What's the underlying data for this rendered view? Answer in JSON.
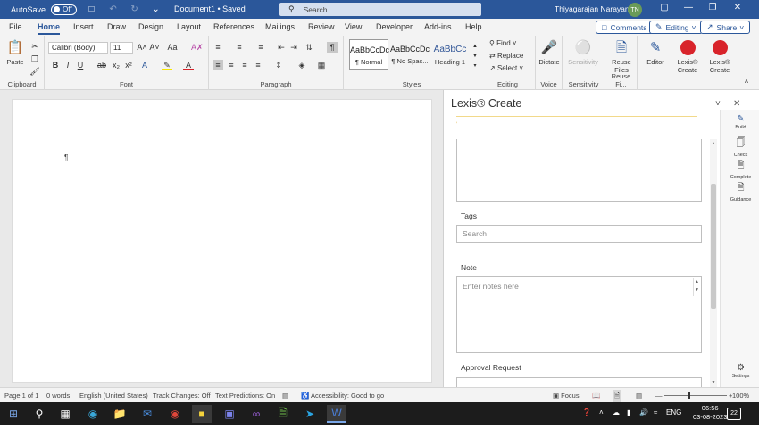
{
  "titlebar": {
    "autosave_label": "AutoSave",
    "autosave_state": "Off",
    "doc_title": "Document1 • Saved",
    "search_placeholder": "Search",
    "user_name": "Thiyagarajan Narayanan",
    "user_initials": "TN"
  },
  "tabs": [
    "File",
    "Home",
    "Insert",
    "Draw",
    "Design",
    "Layout",
    "References",
    "Mailings",
    "Review",
    "View",
    "Developer",
    "Add-ins",
    "Help"
  ],
  "active_tab": "Home",
  "actions": {
    "comments": "Comments",
    "editing": "Editing",
    "share": "Share"
  },
  "ribbon": {
    "clipboard": {
      "label": "Clipboard",
      "paste": "Paste"
    },
    "font": {
      "label": "Font",
      "font_name": "Calibri (Body)",
      "font_size": "11"
    },
    "paragraph": {
      "label": "Paragraph"
    },
    "styles": {
      "label": "Styles",
      "items": [
        {
          "sample": "AaBbCcDc",
          "name": "¶ Normal"
        },
        {
          "sample": "AaBbCcDc",
          "name": "¶ No Spac..."
        },
        {
          "sample": "AaBbCc",
          "name": "Heading 1"
        }
      ]
    },
    "editing": {
      "label": "Editing",
      "find": "Find",
      "replace": "Replace",
      "select": "Select"
    },
    "voice": {
      "label": "Voice",
      "dictate": "Dictate"
    },
    "sensitivity": {
      "label": "Sensitivity",
      "button": "Sensitivity"
    },
    "reuse": {
      "label": "Reuse Fi...",
      "button": "Reuse Files"
    },
    "editor": {
      "button": "Editor"
    },
    "lexis1": {
      "button": "Lexis® Create"
    },
    "lexis2": {
      "button": "Lexis® Create"
    }
  },
  "document": {
    "pilcrow": "¶"
  },
  "pane": {
    "title": "Lexis® Create",
    "tags_label": "Tags",
    "tags_placeholder": "Search",
    "note_label": "Note",
    "note_placeholder": "Enter notes here",
    "approval_label": "Approval Request",
    "tools": [
      {
        "icon": "pencil-icon",
        "label": "Build"
      },
      {
        "icon": "check-icon",
        "label": "Check"
      },
      {
        "icon": "complete-icon",
        "label": "Complete"
      },
      {
        "icon": "guidance-icon",
        "label": "Guidance"
      },
      {
        "icon": "gear-icon",
        "label": "Settings"
      }
    ]
  },
  "status": {
    "page": "Page 1 of 1",
    "words": "0 words",
    "language": "English (United States)",
    "track_changes": "Track Changes: Off",
    "text_predictions": "Text Predictions: On",
    "accessibility": "Accessibility: Good to go",
    "focus": "Focus",
    "zoom": "100%"
  },
  "taskbar": {
    "language": "ENG",
    "time": "06:56",
    "date": "03-08-2023",
    "notifications": "22"
  },
  "colors": {
    "word_blue": "#2b579a",
    "lexis_red": "#d8232a"
  }
}
